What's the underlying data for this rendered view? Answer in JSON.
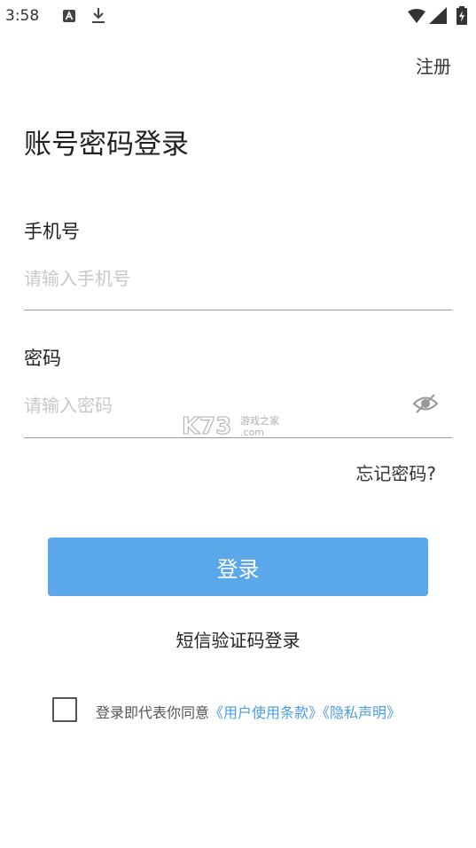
{
  "status_bar": {
    "time": "3:58",
    "icons": [
      "a-notification-icon",
      "download-icon",
      "wifi-icon",
      "signal-icon",
      "battery-icon"
    ]
  },
  "header": {
    "register_label": "注册"
  },
  "title": "账号密码登录",
  "phone": {
    "label": "手机号",
    "placeholder": "请输入手机号",
    "value": ""
  },
  "password": {
    "label": "密码",
    "placeholder": "请输入密码",
    "value": "",
    "visibility_icon": "eye-hidden-icon"
  },
  "watermark": {
    "brand": "K73",
    "site_text": "游戏之家",
    "domain": ".com"
  },
  "forgot_label": "忘记密码?",
  "login_label": "登录",
  "sms_login_label": "短信验证码登录",
  "agreement": {
    "checked": false,
    "prefix": "登录即代表你同意",
    "user_terms": "《用户使用条款》",
    "privacy": "《隐私声明》"
  },
  "colors": {
    "primary_button": "#5aa7ea",
    "link": "#4b9be3",
    "placeholder": "#c8c8c8"
  }
}
